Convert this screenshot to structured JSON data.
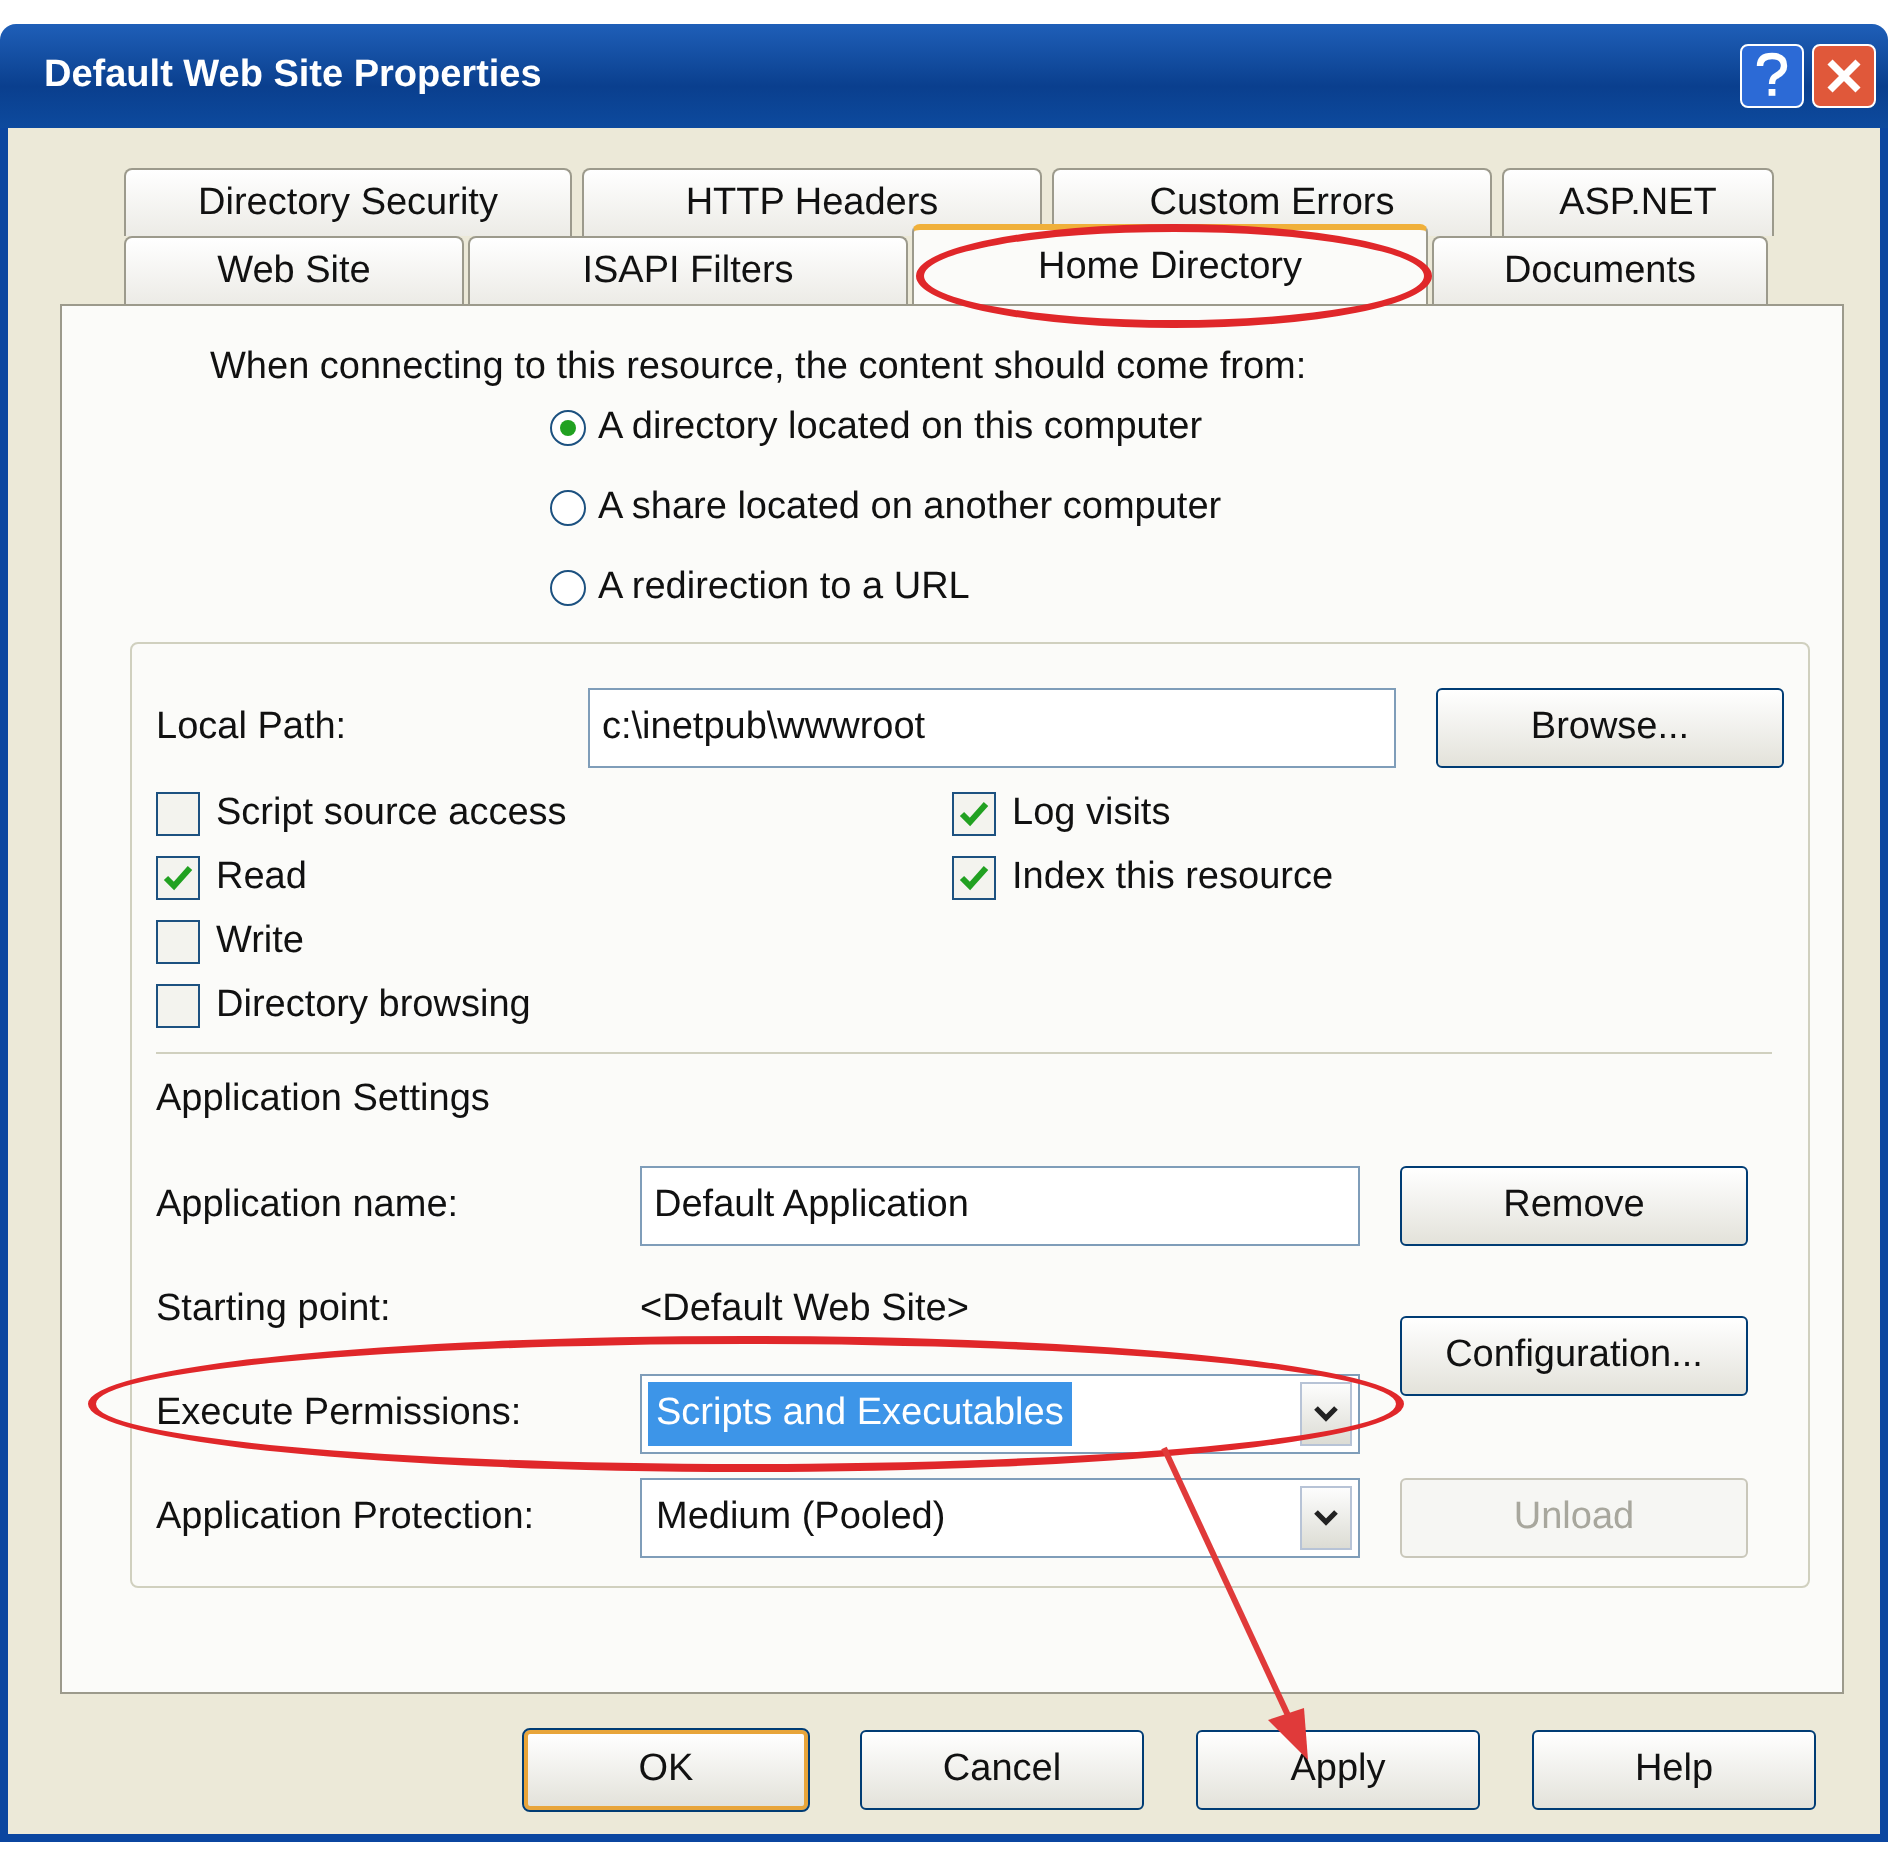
{
  "window": {
    "title": "Default Web Site Properties"
  },
  "tab_rows": [
    [
      {
        "label": "Directory Security",
        "selected": false
      },
      {
        "label": "HTTP Headers",
        "selected": false
      },
      {
        "label": "Custom Errors",
        "selected": false
      },
      {
        "label": "ASP.NET",
        "selected": false
      }
    ],
    [
      {
        "label": "Web Site",
        "selected": false
      },
      {
        "label": "ISAPI Filters",
        "selected": false
      },
      {
        "label": "Home Directory",
        "selected": true
      },
      {
        "label": "Documents",
        "selected": false
      }
    ]
  ],
  "intro": "When connecting to this resource, the content should come from:",
  "source_options": [
    {
      "label": "A directory located on this computer",
      "selected": true
    },
    {
      "label": "A share located on another computer",
      "selected": false
    },
    {
      "label": "A redirection to a URL",
      "selected": false
    }
  ],
  "local_path": {
    "label": "Local Path:",
    "value": "c:\\inetpub\\wwwroot",
    "button": "Browse..."
  },
  "permissions_left": [
    {
      "label": "Script source access",
      "checked": false
    },
    {
      "label": "Read",
      "checked": true
    },
    {
      "label": "Write",
      "checked": false
    },
    {
      "label": "Directory browsing",
      "checked": false
    }
  ],
  "permissions_right": [
    {
      "label": "Log visits",
      "checked": true
    },
    {
      "label": "Index this resource",
      "checked": true
    }
  ],
  "application_settings": {
    "heading": "Application Settings",
    "name_label": "Application name:",
    "name_value": "Default Application",
    "remove_button": "Remove",
    "starting_label": "Starting point:",
    "starting_value": "<Default Web Site>",
    "configuration_button": "Configuration...",
    "execute_label": "Execute Permissions:",
    "execute_value": "Scripts and Executables",
    "execute_highlighted": true,
    "protection_label": "Application Protection:",
    "protection_value": "Medium (Pooled)",
    "unload_button": {
      "label": "Unload",
      "disabled": true
    }
  },
  "buttons": [
    {
      "label": "OK",
      "default": true
    },
    {
      "label": "Cancel",
      "default": false
    },
    {
      "label": "Apply",
      "default": false
    },
    {
      "label": "Help",
      "default": false
    }
  ]
}
